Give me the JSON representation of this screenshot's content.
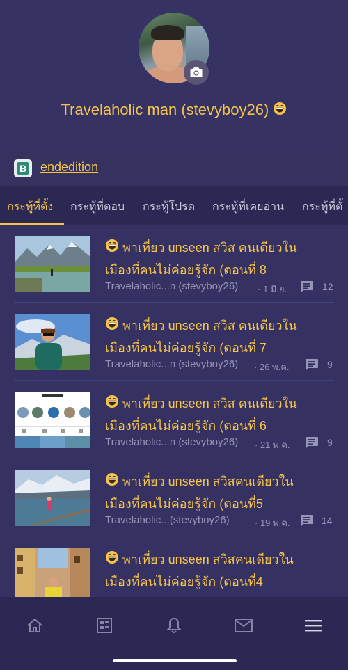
{
  "profile": {
    "display_name": "Travelaholic man (stevyboy26)",
    "avatar_icon": "user-avatar-photo",
    "camera_icon": "camera-icon",
    "status_emoji": "grinning-face-emoji"
  },
  "edition": {
    "logo_letter": "B",
    "link_label": "endedition"
  },
  "tabs": [
    {
      "label": "กระทู้ที่ตั้ง",
      "active": true
    },
    {
      "label": "กระทู้ที่ตอบ",
      "active": false
    },
    {
      "label": "กระทู้โปรด",
      "active": false
    },
    {
      "label": "กระทู้ที่เคยอ่าน",
      "active": false
    },
    {
      "label": "กระทู้ที่ตั้",
      "active": false
    }
  ],
  "threads": [
    {
      "title_line1": "พาเที่ยว unseen สวิส คนเดียวใน",
      "title_line2": "เมืองที่คนไม่ค่อยรู้จัก (ตอนที่ 8",
      "author": "Travelaholic...n (stevyboy26)",
      "date": "· 1 มิ.ย.",
      "comments": "12"
    },
    {
      "title_line1": "พาเที่ยว unseen สวิส คนเดียวใน",
      "title_line2": "เมืองที่คนไม่ค่อยรู้จัก (ตอนที่ 7",
      "author": "Travelaholic...n (stevyboy26)",
      "date": "· 26 พ.ค.",
      "comments": "9"
    },
    {
      "title_line1": "พาเที่ยว unseen สวิส คนเดียวใน",
      "title_line2": "เมืองที่คนไม่ค่อยรู้จัก (ตอนที่ 6",
      "author": "Travelaholic...n (stevyboy26)",
      "date": "· 21 พ.ค.",
      "comments": "9"
    },
    {
      "title_line1": "พาเที่ยว unseen สวิสคนเดียวใน",
      "title_line2": "เมืองที่คนไม่ค่อยรู้จัก (ตอนที่5",
      "author": "Travelaholic...(stevyboy26)",
      "date": "· 19 พ.ค.",
      "comments": "14"
    },
    {
      "title_line1": "พาเที่ยว unseen สวิสคนเดียวใน",
      "title_line2": "เมืองที่คนไม่ค่อยรู้จัก (ตอนที่4",
      "author": "",
      "date": "",
      "comments": ""
    }
  ],
  "bottom_nav": {
    "items": [
      "home-icon",
      "feed-icon",
      "bell-icon",
      "mail-icon",
      "menu-icon"
    ],
    "active_index": 4
  },
  "colors": {
    "background": "#353263",
    "accent": "#f5c34a",
    "bar": "#2b2853",
    "muted": "#9795b6"
  }
}
